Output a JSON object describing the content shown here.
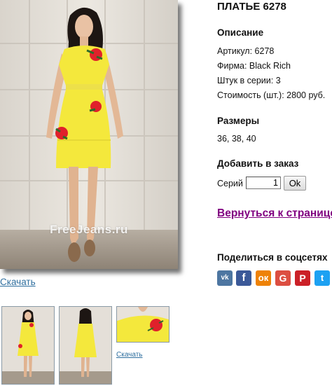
{
  "product": {
    "title": "ПЛАТЬЕ 6278",
    "description_heading": "Описание",
    "article": "Артикул: 6278",
    "brand": "Фирма: Black Rich",
    "pieces": "Штук в серии: 3",
    "cost": "Стоимость (шт.): 2800 руб.",
    "sizes_heading": "Размеры",
    "sizes": "36, 38, 40"
  },
  "order": {
    "heading": "Добавить в заказ",
    "series_label": "Серий",
    "quantity": "1",
    "ok_label": "Ok"
  },
  "navigation": {
    "back_label": "Вернуться к странице"
  },
  "share": {
    "heading": "Поделиться в соцсетях",
    "buttons": [
      {
        "name": "vk",
        "glyph": "vk",
        "color": "#4d76a1"
      },
      {
        "name": "facebook",
        "glyph": "f",
        "color": "#3b5998"
      },
      {
        "name": "odnoklassniki",
        "glyph": "ок",
        "color": "#ee8208"
      },
      {
        "name": "google-plus",
        "glyph": "G",
        "color": "#dc4e41"
      },
      {
        "name": "pinterest",
        "glyph": "P",
        "color": "#cb2027"
      },
      {
        "name": "twitter",
        "glyph": "t",
        "color": "#1da1f2"
      }
    ]
  },
  "images": {
    "watermark": "FreeJeans.ru",
    "download_label": "Скачать",
    "thumb_download_label": "Скачать",
    "dress_color": "#f4e83c",
    "rose_color": "#e0212b"
  }
}
